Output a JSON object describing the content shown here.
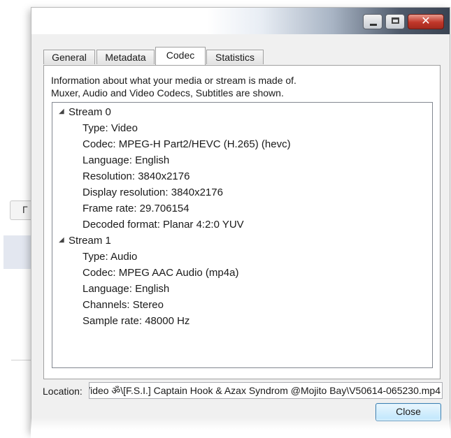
{
  "window": {
    "minimize_glyph": "",
    "close_glyph": "✕"
  },
  "background": {
    "button_label": "Г"
  },
  "tabs": [
    {
      "label": "General"
    },
    {
      "label": "Metadata"
    },
    {
      "label": "Codec"
    },
    {
      "label": "Statistics"
    }
  ],
  "active_tab": "Codec",
  "description": {
    "line1": "Information about what your media or stream is made of.",
    "line2": "Muxer, Audio and Video Codecs, Subtitles are shown."
  },
  "streams": [
    {
      "title": "Stream 0",
      "expander": "◢",
      "props": [
        "Type: Video",
        "Codec: MPEG-H Part2/HEVC (H.265) (hevc)",
        "Language: English",
        "Resolution: 3840x2176",
        "Display resolution: 3840x2176",
        "Frame rate: 29.706154",
        "Decoded format: Planar 4:2:0 YUV"
      ]
    },
    {
      "title": "Stream 1",
      "expander": "◢",
      "props": [
        "Type: Audio",
        "Codec: MPEG AAC Audio (mp4a)",
        "Language: English",
        "Channels: Stereo",
        "Sample rate: 48000 Hz"
      ]
    }
  ],
  "location": {
    "label": "Location:",
    "value": "/ideo ॐ\\[F.S.I.] Captain Hook & Azax Syndrom @Mojito Bay\\V50614-065230.mp4"
  },
  "close_button": "Close"
}
